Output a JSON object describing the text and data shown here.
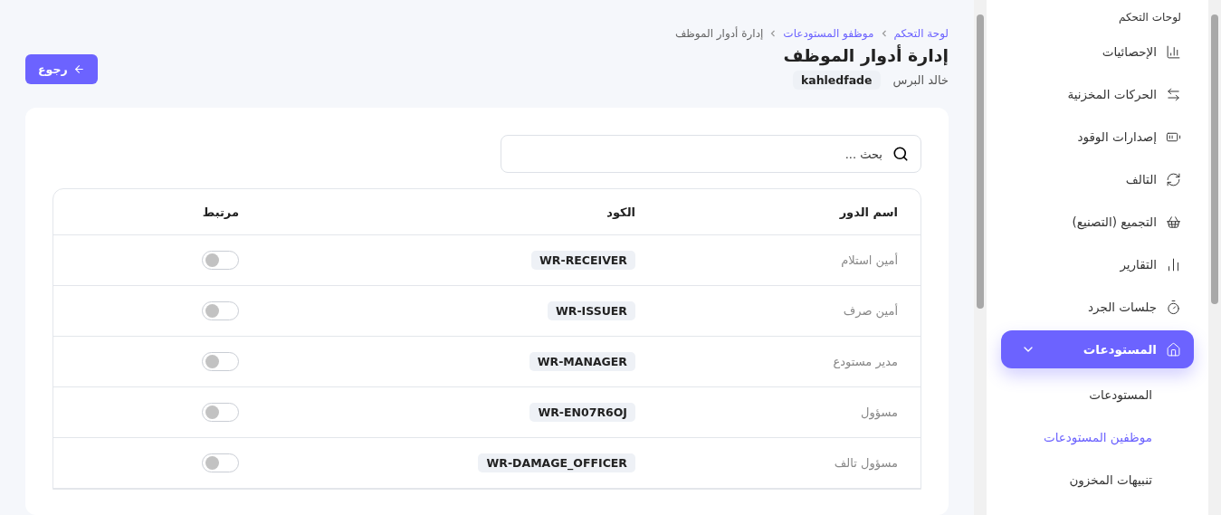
{
  "breadcrumb": [
    {
      "label": "لوحة التحكم",
      "link": true
    },
    {
      "label": "موظفو المستودعات",
      "link": true
    },
    {
      "label": "إدارة أدوار الموظف",
      "link": false
    }
  ],
  "title": "إدارة أدوار الموظف",
  "employee": {
    "name": "خالد البرس",
    "username": "kahledfade"
  },
  "back_button": "رجوع",
  "search": {
    "placeholder": "بحث ..."
  },
  "table": {
    "columns": [
      "اسم الدور",
      "الكود",
      "مرتبط"
    ],
    "rows": [
      {
        "name": "أمين استلام",
        "code": "WR-RECEIVER",
        "linked": false
      },
      {
        "name": "أمين صرف",
        "code": "WR-ISSUER",
        "linked": false
      },
      {
        "name": "مدير مستودع",
        "code": "WR-MANAGER",
        "linked": false
      },
      {
        "name": "مسؤول",
        "code": "WR-EN07R6OJ",
        "linked": false
      },
      {
        "name": "مسؤول تالف",
        "code": "WR-DAMAGE_OFFICER",
        "linked": false
      }
    ]
  },
  "sidebar": {
    "heading": "لوحات التحكم",
    "items": [
      {
        "label": "الإحصائيات",
        "selected": false
      },
      {
        "label": "الحركات المخزنية",
        "selected": false
      },
      {
        "label": "إصدارات الوقود",
        "selected": false
      },
      {
        "label": "التالف",
        "selected": false
      },
      {
        "label": "التجميع (التصنيع)",
        "selected": false
      },
      {
        "label": "التقارير",
        "selected": false
      },
      {
        "label": "جلسات الجرد",
        "selected": false
      },
      {
        "label": "المستودعات",
        "selected": true,
        "expanded": true,
        "children": [
          {
            "label": "المستودعات",
            "selected": false
          },
          {
            "label": "موظفين المستودعات",
            "selected": true
          },
          {
            "label": "تنبيهات المخزون",
            "selected": false
          }
        ]
      }
    ]
  }
}
